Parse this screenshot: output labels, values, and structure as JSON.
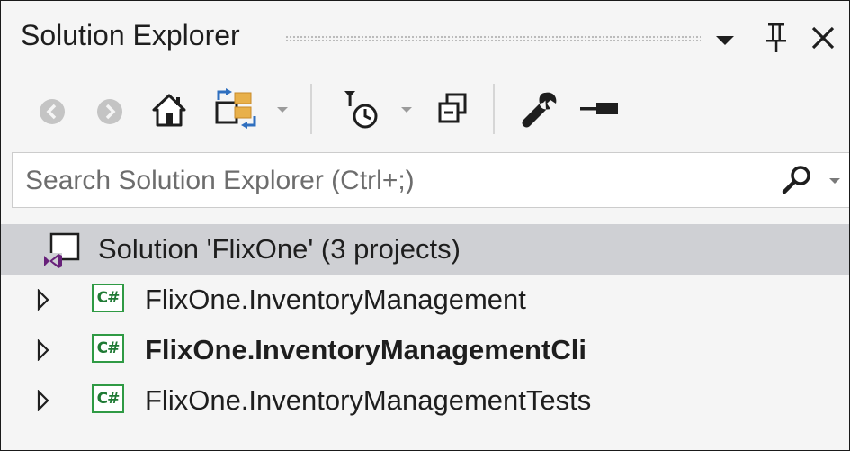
{
  "panel": {
    "title": "Solution Explorer"
  },
  "title_icons": [
    "dropdown-arrow-icon",
    "pin-icon",
    "close-icon"
  ],
  "toolbar": {
    "buttons": [
      "back-icon",
      "forward-icon",
      "home-icon",
      "switch-views-icon",
      "pending-changes-filter-icon",
      "collapse-all-icon",
      "properties-icon",
      "preview-icon"
    ]
  },
  "search": {
    "placeholder": "Search Solution Explorer (Ctrl+;)",
    "icon": "search-icon"
  },
  "tree": {
    "solution_label": "Solution 'FlixOne' (3 projects)",
    "projects": [
      {
        "label": "FlixOne.InventoryManagement",
        "bold": false,
        "icon_text": "C#"
      },
      {
        "label": "FlixOne.InventoryManagementCli",
        "bold": true,
        "icon_text": "C#"
      },
      {
        "label": "FlixOne.InventoryManagementTests",
        "bold": false,
        "icon_text": "C#"
      }
    ]
  },
  "colors": {
    "background": "#f5f5f5",
    "selected_row": "#cfd0d4",
    "csharp_icon": "#2f9a44",
    "vs_purple": "#68217a"
  }
}
